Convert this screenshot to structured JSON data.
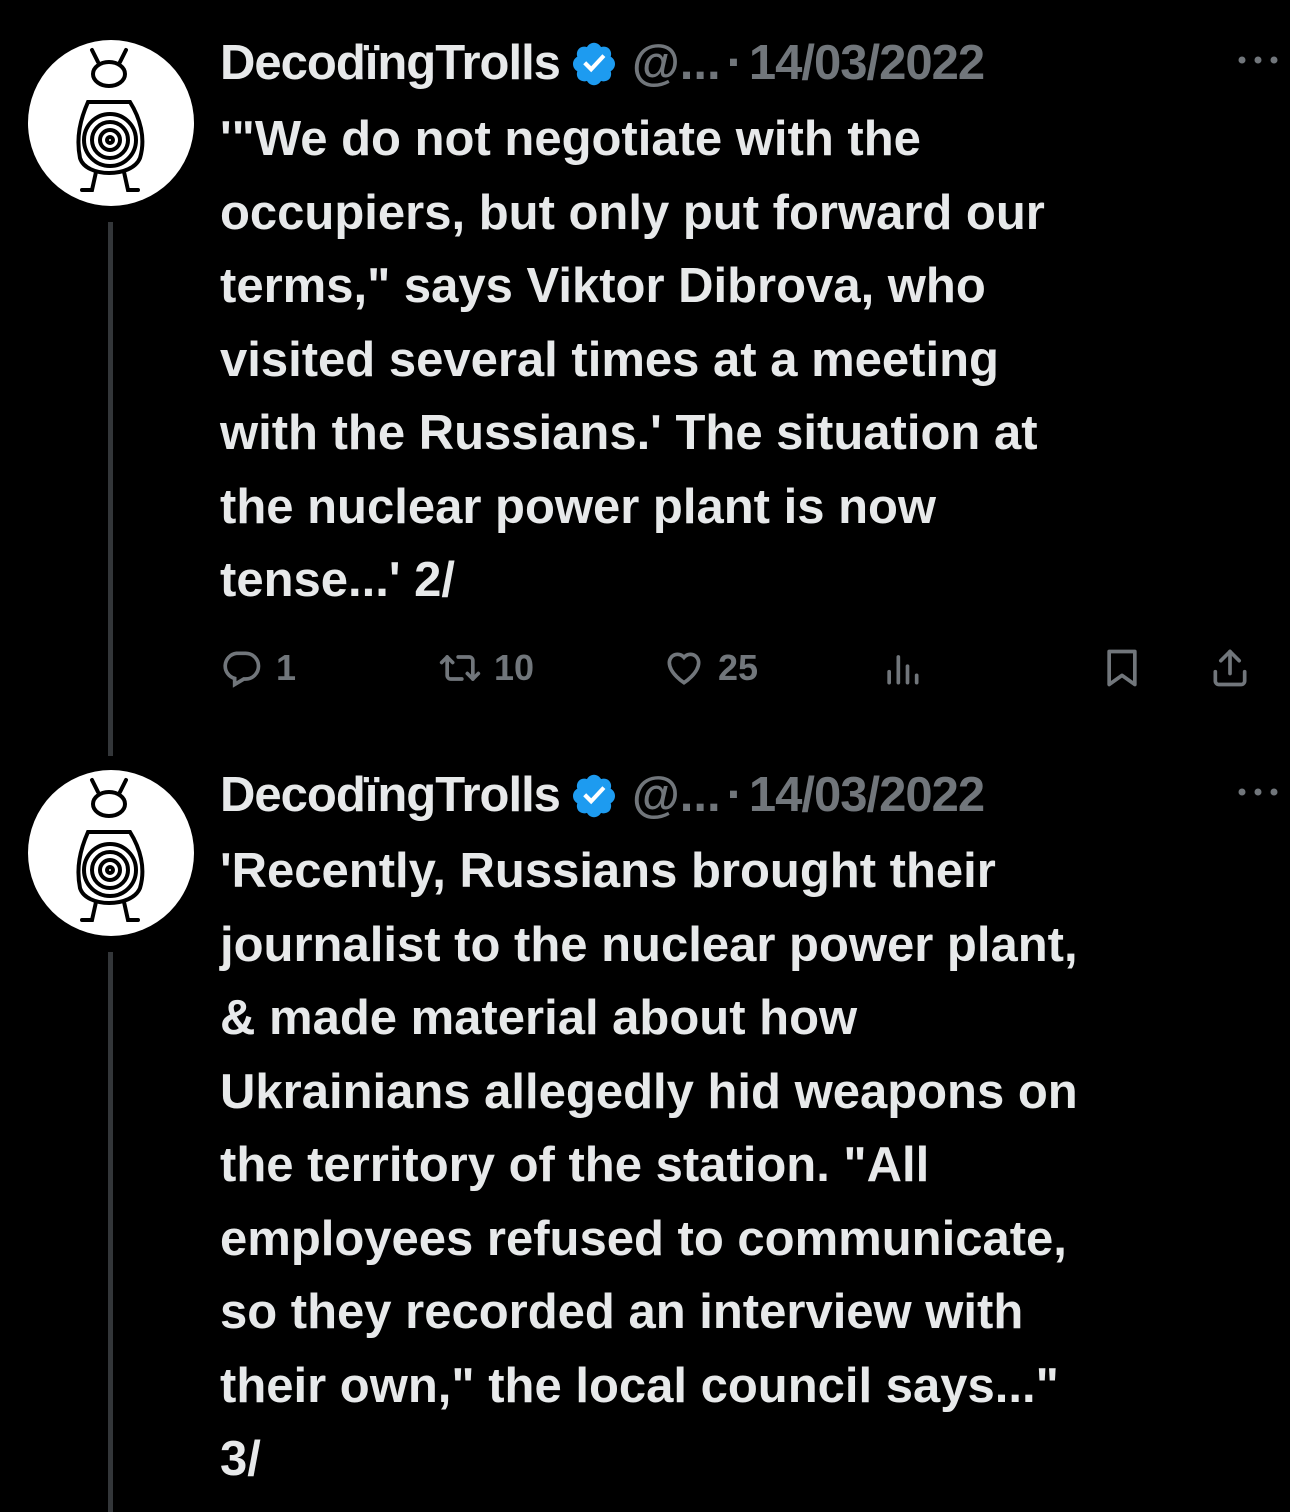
{
  "tweets": [
    {
      "author": "DecodïngTrolls",
      "handle": "@...",
      "separator": "·",
      "date": "14/03/2022",
      "text": "'\"We do not negotiate with the\noccupiers, but only put forward our\nterms,\" says Viktor Dibrova, who\nvisited several times at a meeting\nwith the Russians.' The situation at\nthe nuclear power plant is now\ntense...' 2/",
      "counts": {
        "replies": "1",
        "retweets": "10",
        "likes": "25"
      }
    },
    {
      "author": "DecodïngTrolls",
      "handle": "@...",
      "separator": "·",
      "date": "14/03/2022",
      "text": "'Recently, Russians brought their\njournalist to the nuclear power plant,\n& made material about how\nUkrainians allegedly hid weapons on\nthe territory of the station. \"All\nemployees refused to communicate,\nso they recorded an interview with\ntheir own,\" the local council says...\"\n3/"
    }
  ],
  "icons": {
    "verified": "verified-badge-icon",
    "more": "more-options-icon",
    "reply": "reply-icon",
    "retweet": "retweet-icon",
    "like": "heart-icon",
    "views": "views-icon",
    "bookmark": "bookmark-icon",
    "share": "share-icon"
  },
  "colors": {
    "background": "#000000",
    "text": "#e7e9ea",
    "secondary": "#71767b",
    "verified": "#1d9bf0",
    "thread_line": "#333639"
  }
}
